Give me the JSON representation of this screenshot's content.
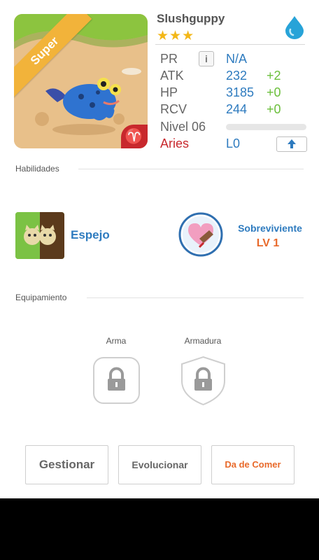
{
  "monster": {
    "name": "Slushguppy",
    "rarity_stars": "★★★",
    "rarity_label": "Super",
    "element": "water",
    "portrait_badge_glyph": "♈"
  },
  "stats": {
    "pr": {
      "label": "PR",
      "value": "N/A"
    },
    "atk": {
      "label": "ATK",
      "value": "232",
      "bonus": "+2"
    },
    "hp": {
      "label": "HP",
      "value": "3185",
      "bonus": "+0"
    },
    "rcv": {
      "label": "RCV",
      "value": "244",
      "bonus": "+0"
    },
    "level": {
      "label": "Nivel 06",
      "progress": 0
    },
    "sign": {
      "label": "Aries",
      "value": "L0"
    }
  },
  "icons": {
    "info": "i",
    "upgrade": "arrow-up-icon"
  },
  "skills_section": {
    "title": "Habilidades",
    "skills": [
      {
        "name": "Espejo",
        "icon": "mirror-cats-icon"
      },
      {
        "name": "Sobreviviente",
        "level": "LV 1",
        "icon": "heart-shield-icon"
      }
    ]
  },
  "equipment_section": {
    "title": "Equipamiento",
    "slots": [
      {
        "label": "Arma",
        "locked": true
      },
      {
        "label": "Armadura",
        "locked": true
      }
    ]
  },
  "buttons": {
    "manage": "Gestionar",
    "evolve": "Evolucionar",
    "feed": "Da de Comer"
  },
  "colors": {
    "accent_blue": "#2e7bbf",
    "bonus_green": "#6abf3a",
    "aries_red": "#c8282d",
    "feed_orange": "#e8692a",
    "star_gold": "#f3b718"
  }
}
